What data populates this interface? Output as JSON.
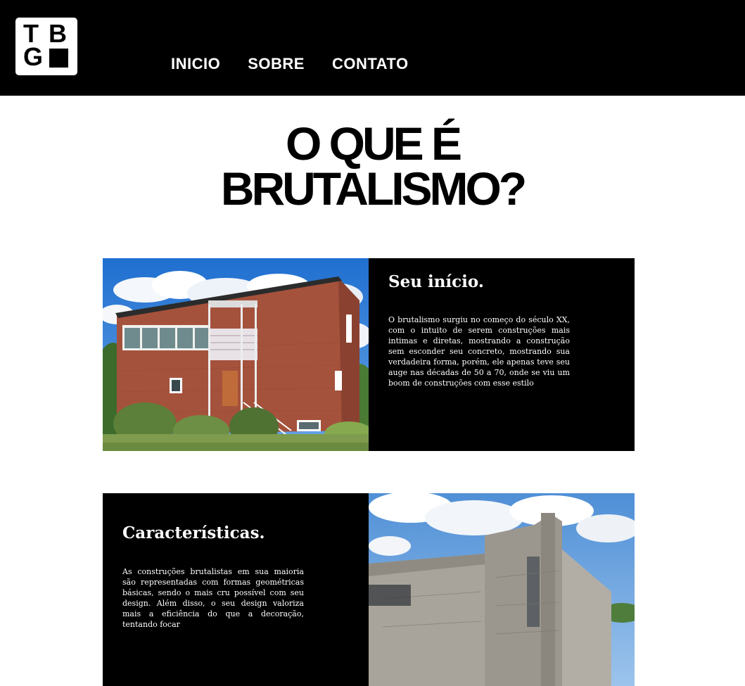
{
  "header": {
    "logo": {
      "letters": [
        "T",
        "B",
        "G"
      ]
    },
    "nav": [
      {
        "label": "INICIO"
      },
      {
        "label": "SOBRE"
      },
      {
        "label": "CONTATO"
      }
    ]
  },
  "main": {
    "title_line1": "O QUE É",
    "title_line2": "BRUTALISMO?",
    "sections": [
      {
        "heading": "Seu início.",
        "body": "O brutalismo surgiu no começo do século XX, com o intuito de serem construções mais intimas e diretas, mostrando a construção sem esconder seu concreto, mostrando sua verdadeira forma, porém, ele apenas teve seu auge nas décadas de 50 a 70, onde se viu um boom de construções com esse estilo"
      },
      {
        "heading": "Características.",
        "body": "As construções brutalistas em sua maioria são representadas com formas geométricas básicas, sendo o mais cru possível com seu design. Além disso, o seu design valoriza mais a eficiência do que a decoração, tentando focar"
      }
    ]
  },
  "colors": {
    "header_bg": "#000000",
    "text_block_bg": "#000000",
    "page_bg": "#ffffff"
  }
}
